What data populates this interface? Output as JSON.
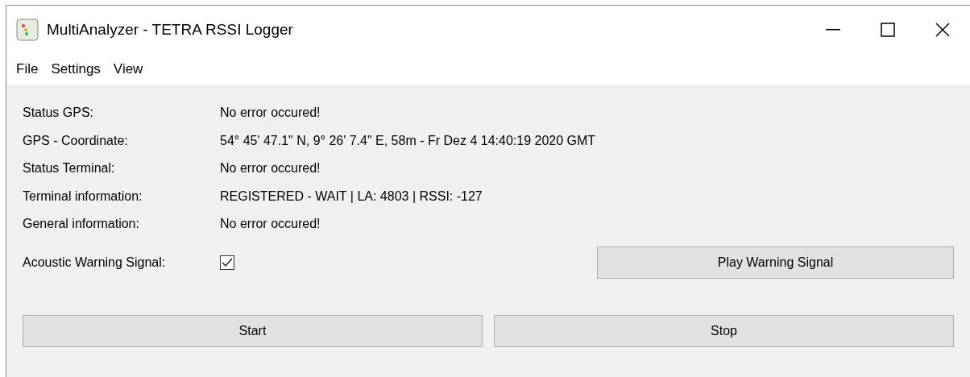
{
  "window": {
    "title": "MultiAnalyzer - TETRA RSSI Logger"
  },
  "menu": [
    "File",
    "Settings",
    "View"
  ],
  "fields": [
    {
      "label": "Status GPS:",
      "value": "No error occured!"
    },
    {
      "label": "GPS - Coordinate:",
      "value": "54° 45' 47.1\" N, 9° 26' 7.4\" E, 58m - Fr Dez 4 14:40:19 2020 GMT"
    },
    {
      "label": "Status Terminal:",
      "value": "No error occured!"
    },
    {
      "label": "Terminal information:",
      "value": "REGISTERED - WAIT | LA: 4803 | RSSI: -127"
    },
    {
      "label": "General information:",
      "value": "No error occured!"
    }
  ],
  "warning": {
    "label": "Acoustic Warning Signal:",
    "checked": true,
    "button": "Play Warning Signal"
  },
  "buttons": [
    "Start",
    "Stop"
  ]
}
